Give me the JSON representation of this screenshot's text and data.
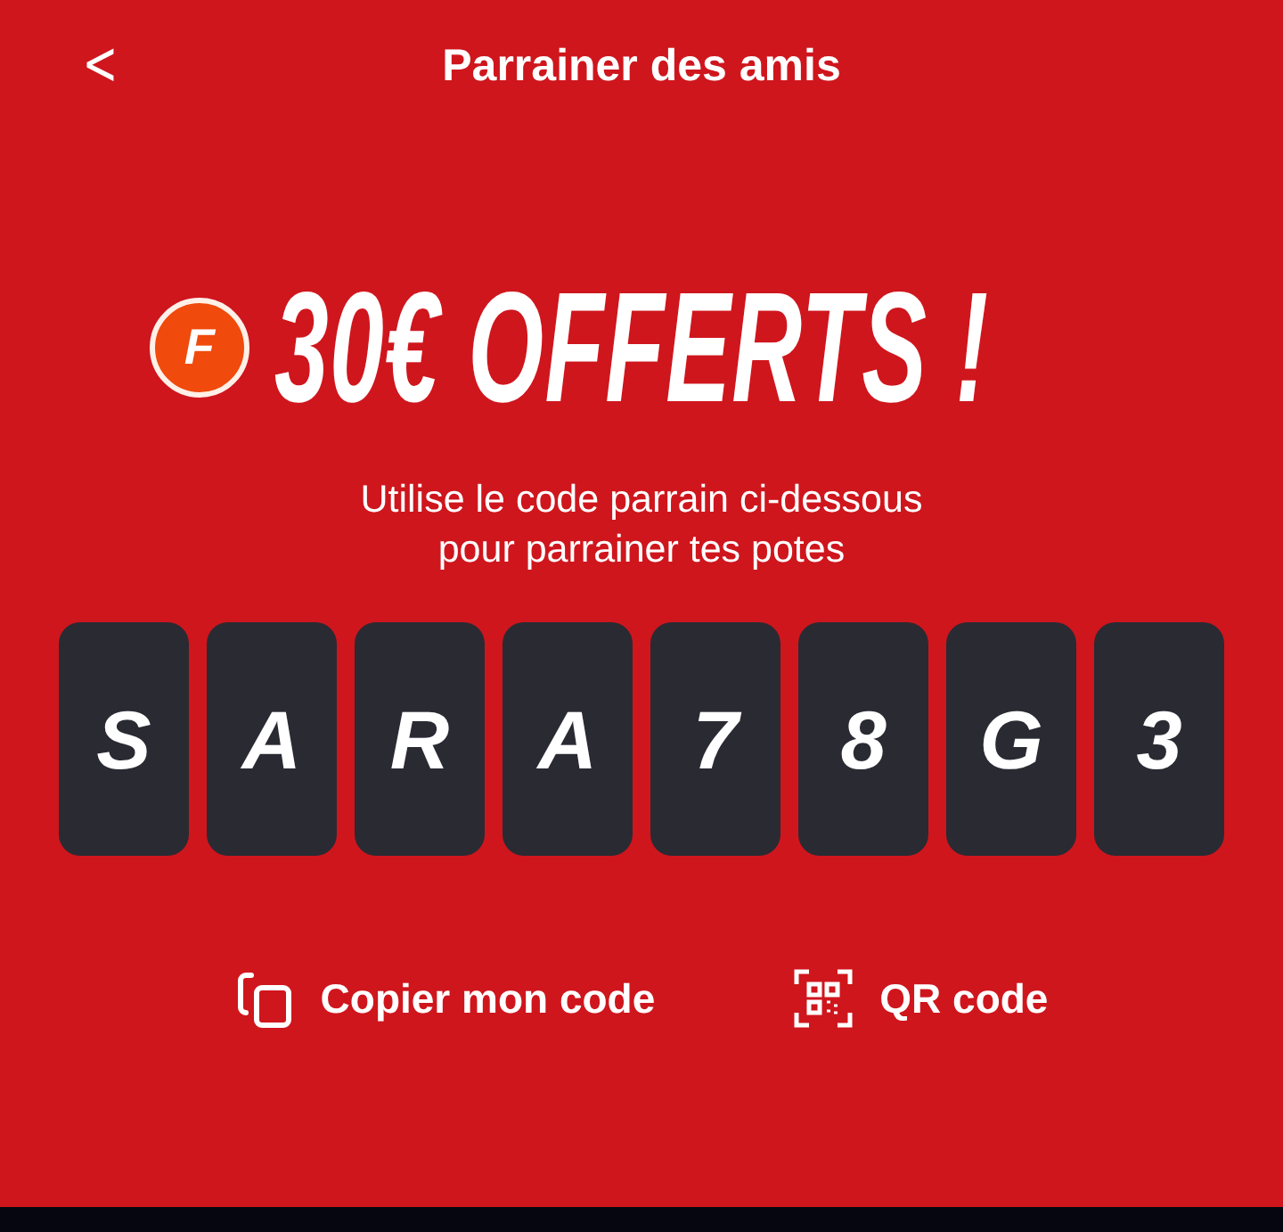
{
  "header": {
    "back": "<",
    "title": "Parrainer des amis"
  },
  "offer": {
    "logo_letter": "F",
    "headline": "30€ OFFERTS !"
  },
  "instructions": [
    "Utilise le code parrain ci-dessous",
    "pour parrainer tes potes"
  ],
  "code": [
    "S",
    "A",
    "R",
    "A",
    "7",
    "8",
    "G",
    "3"
  ],
  "actions": [
    {
      "kind": "copy",
      "label": "Copier mon code"
    },
    {
      "kind": "qr",
      "label": "QR code"
    }
  ]
}
